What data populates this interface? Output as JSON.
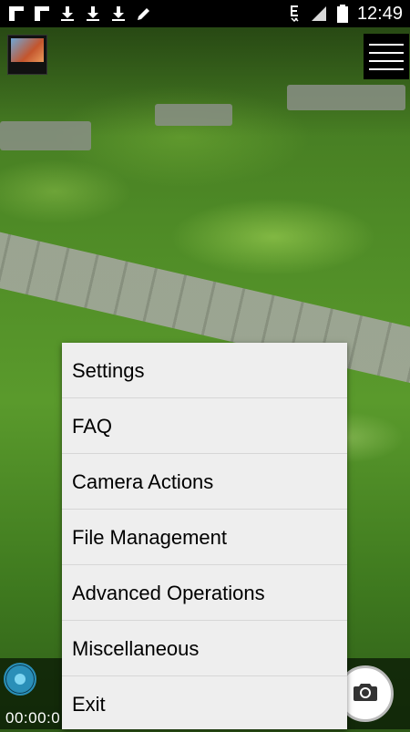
{
  "status_bar": {
    "left_icons": [
      "notification-square-icon",
      "notification-square-icon",
      "download-icon",
      "download-icon",
      "download-icon",
      "pencil-icon"
    ],
    "right_icons": [
      "data-e-icon",
      "signal-icon",
      "battery-icon"
    ],
    "time": "12:49"
  },
  "camera": {
    "timer": "00:00:0"
  },
  "menu": {
    "items": [
      {
        "label": "Settings"
      },
      {
        "label": "FAQ"
      },
      {
        "label": "Camera Actions"
      },
      {
        "label": "File Management"
      },
      {
        "label": "Advanced Operations"
      },
      {
        "label": "Miscellaneous"
      },
      {
        "label": "Exit"
      }
    ]
  },
  "colors": {
    "popup_bg": "#eeeeee",
    "slider_accent": "#2a8fb8",
    "status_bar_bg": "#000000"
  }
}
